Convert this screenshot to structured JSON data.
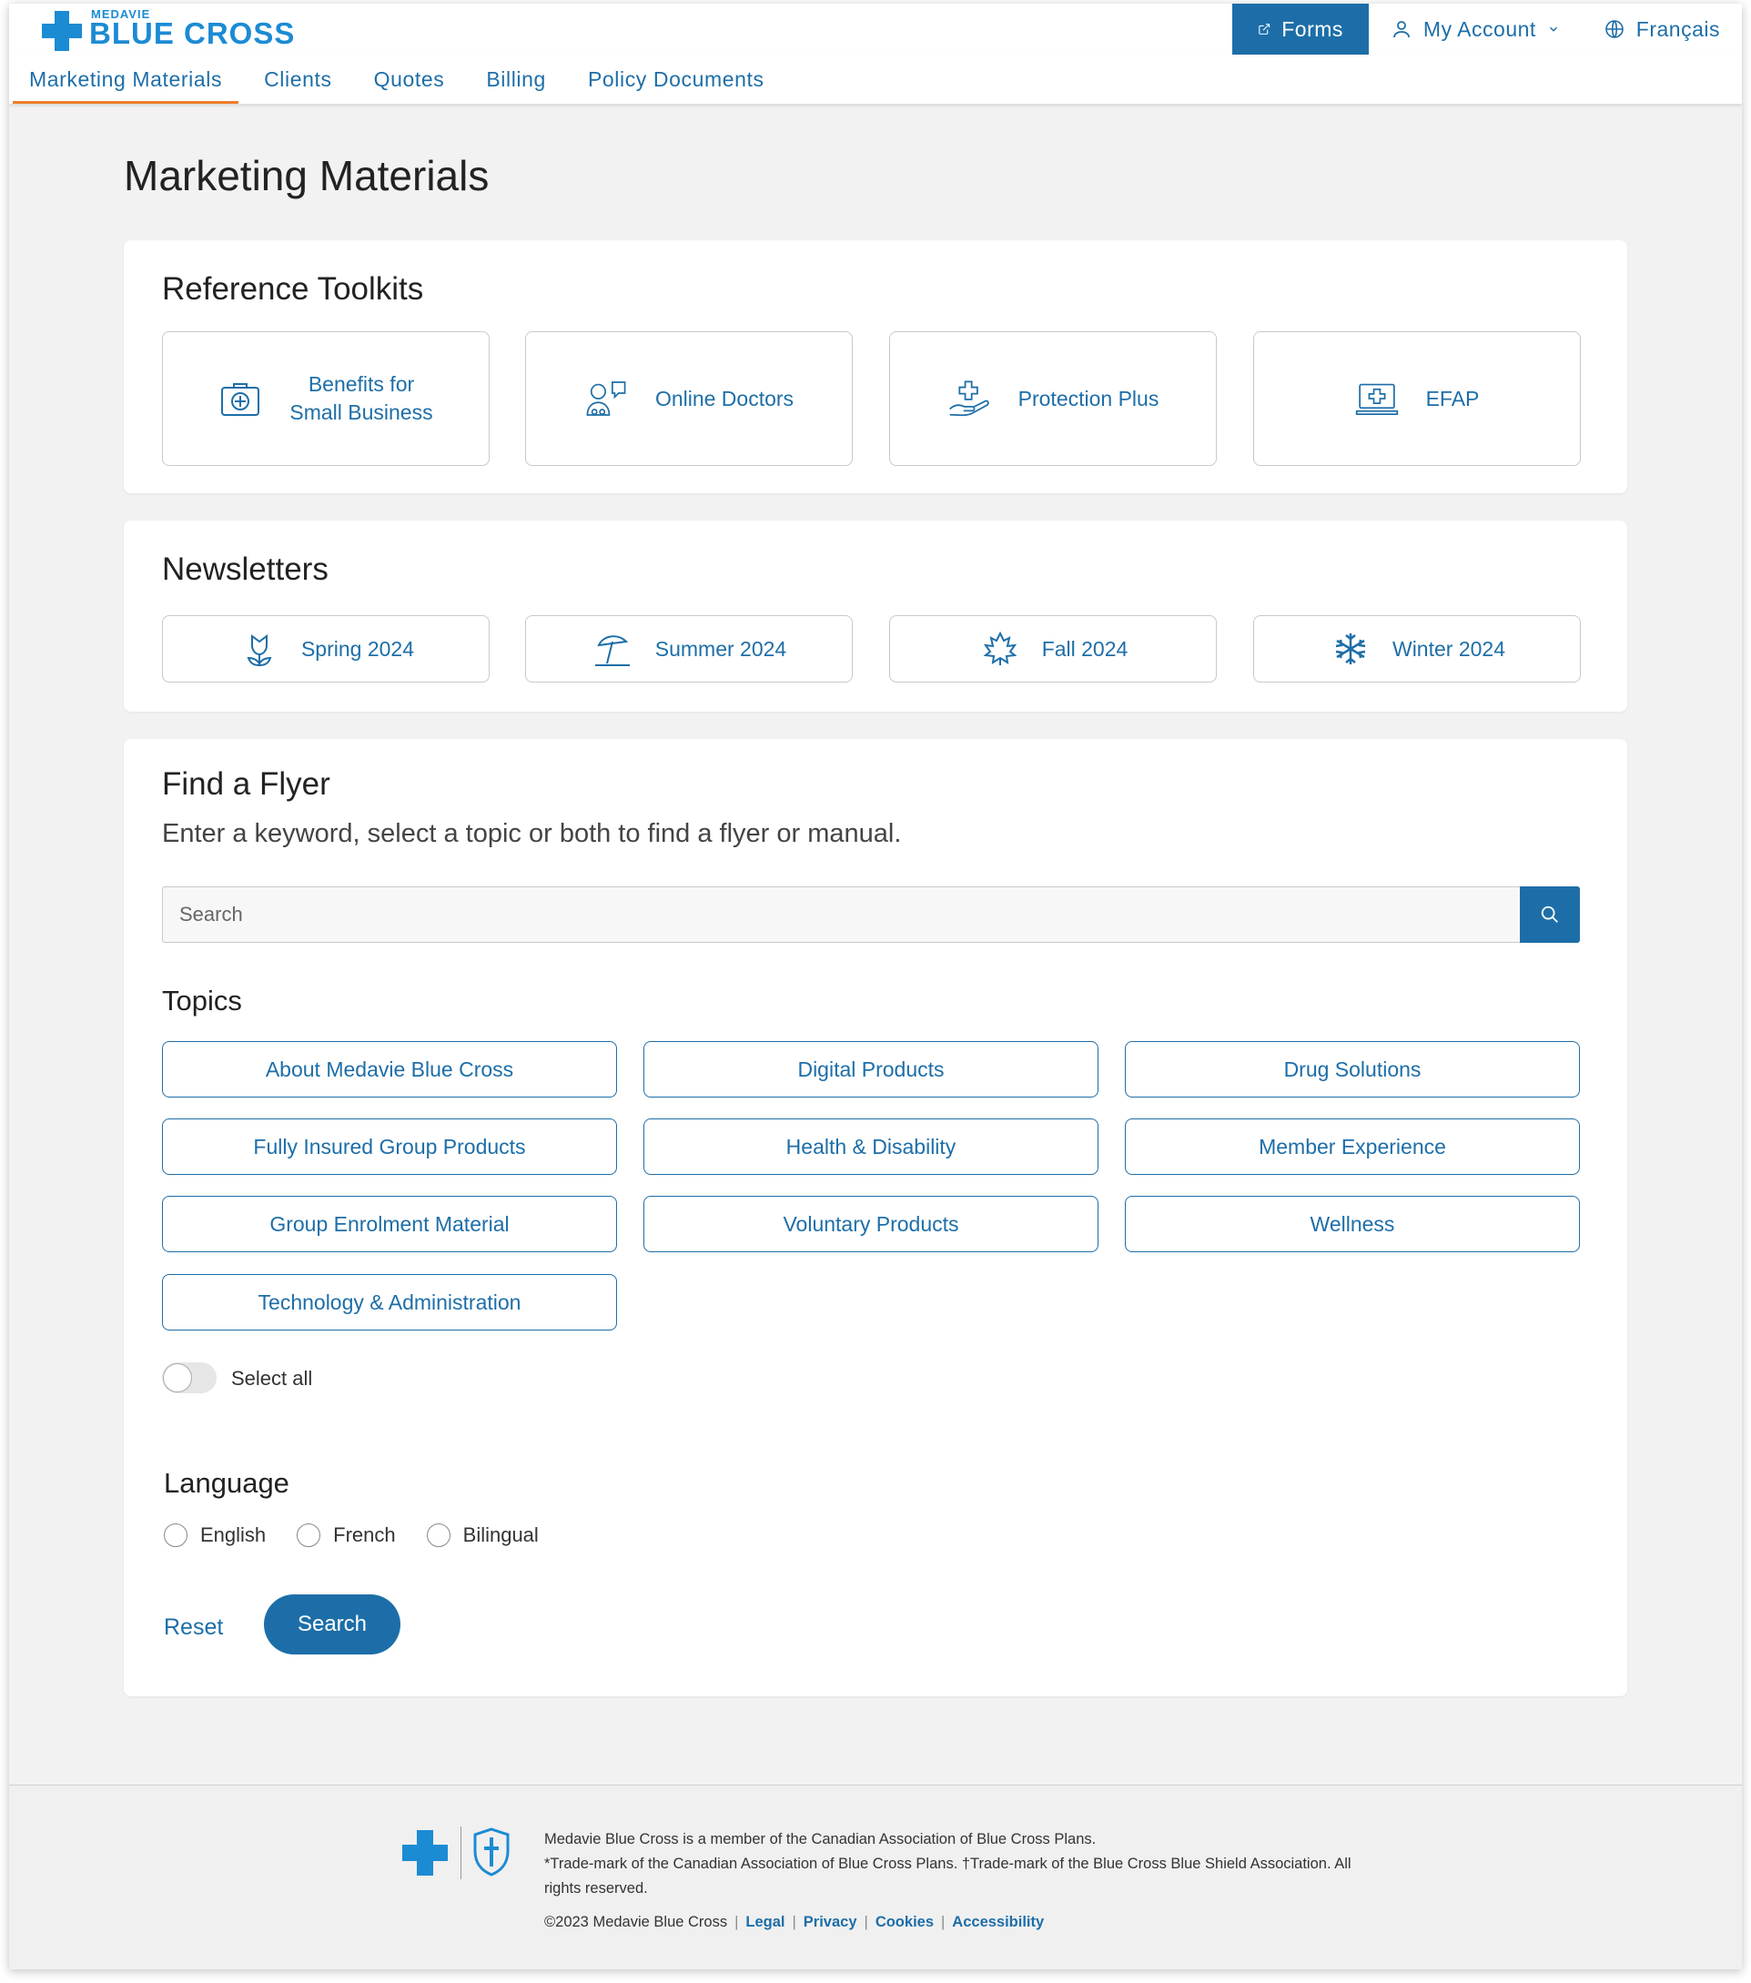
{
  "brand": {
    "logo_small": "MEDAVIE",
    "logo_big": "BLUE CROSS"
  },
  "header": {
    "forms_label": "Forms",
    "account_label": "My Account",
    "language_label": "Français"
  },
  "nav": {
    "items": [
      {
        "label": "Marketing Materials",
        "active": true
      },
      {
        "label": "Clients"
      },
      {
        "label": "Quotes"
      },
      {
        "label": "Billing"
      },
      {
        "label": "Policy Documents"
      }
    ]
  },
  "page": {
    "title": "Marketing Materials"
  },
  "toolkits": {
    "title": "Reference Toolkits",
    "items": [
      {
        "label_line1": "Benefits for",
        "label_line2": "Small Business",
        "icon": "first-aid-kit-icon"
      },
      {
        "label": "Online Doctors",
        "icon": "doctor-chat-icon"
      },
      {
        "label": "Protection Plus",
        "icon": "hand-cross-icon"
      },
      {
        "label": "EFAP",
        "icon": "laptop-cross-icon"
      }
    ]
  },
  "newsletters": {
    "title": "Newsletters",
    "items": [
      {
        "label": "Spring 2024",
        "icon": "tulip-icon"
      },
      {
        "label": "Summer 2024",
        "icon": "beach-umbrella-icon"
      },
      {
        "label": "Fall 2024",
        "icon": "maple-leaf-icon"
      },
      {
        "label": "Winter 2024",
        "icon": "snowflake-icon"
      }
    ]
  },
  "flyer": {
    "title": "Find a Flyer",
    "subtitle": "Enter a keyword, select a topic or both to find a flyer or manual.",
    "search_placeholder": "Search",
    "search_value": "",
    "topics_title": "Topics",
    "topics": [
      "About Medavie Blue Cross",
      "Digital Products",
      "Drug Solutions",
      "Fully Insured Group Products",
      "Health & Disability",
      "Member Experience",
      "Group Enrolment Material",
      "Voluntary Products",
      "Wellness",
      "Technology & Administration"
    ],
    "select_all_label": "Select all",
    "select_all_on": false,
    "language_title": "Language",
    "languages": [
      "English",
      "French",
      "Bilingual"
    ],
    "reset_label": "Reset",
    "search_label": "Search"
  },
  "footer": {
    "line1": "Medavie Blue Cross is a member of the Canadian Association of Blue Cross Plans.",
    "line2": "*Trade-mark of the Canadian Association of Blue Cross Plans. †Trade-mark of the Blue Cross Blue Shield Association. All rights reserved.",
    "copyright": "©2023 Medavie Blue Cross",
    "links": [
      "Legal",
      "Privacy",
      "Cookies",
      "Accessibility"
    ]
  },
  "colors": {
    "primary": "#1d6ea8",
    "brand_blue": "#1b8bd4",
    "nav_active_underline": "#ef7d2b",
    "page_bg": "#f2f2f2"
  }
}
